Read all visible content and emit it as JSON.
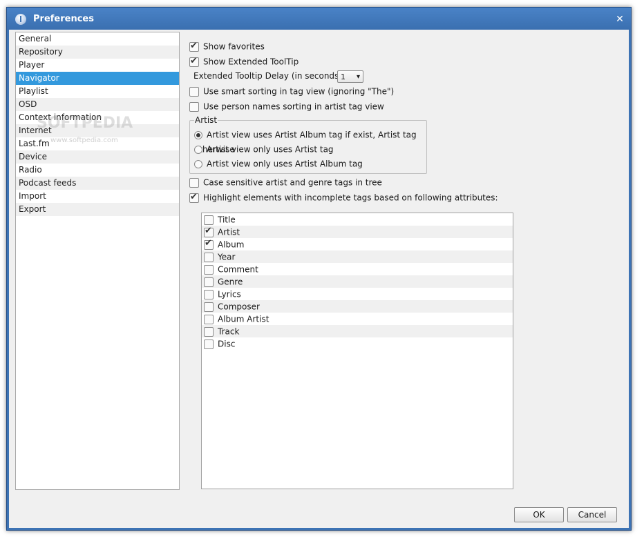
{
  "window": {
    "title": "Preferences",
    "icon": "app-icon",
    "close_glyph": "✕",
    "accent": "#3d73b4",
    "selection_color": "#3399dd"
  },
  "sidebar": {
    "items": [
      {
        "label": "General"
      },
      {
        "label": "Repository"
      },
      {
        "label": "Player"
      },
      {
        "label": "Navigator",
        "selected": true
      },
      {
        "label": "Playlist"
      },
      {
        "label": "OSD"
      },
      {
        "label": "Context information"
      },
      {
        "label": "Internet"
      },
      {
        "label": "Last.fm"
      },
      {
        "label": "Device"
      },
      {
        "label": "Radio"
      },
      {
        "label": "Podcast feeds"
      },
      {
        "label": "Import"
      },
      {
        "label": "Export"
      }
    ]
  },
  "watermark": {
    "text": "SOFTPEDIA",
    "url": "www.softpedia.com"
  },
  "options": {
    "show_favorites": {
      "label": "Show favorites",
      "checked": true
    },
    "show_extended_tooltip": {
      "label": "Show Extended ToolTip",
      "checked": true
    },
    "tooltip_delay": {
      "label": "Extended Tooltip Delay (in seconds)",
      "value": "1"
    },
    "smart_sorting": {
      "label": "Use smart sorting in tag view (ignoring \"The\")",
      "checked": false
    },
    "person_names_sorting": {
      "label": "Use person names sorting in artist tag view",
      "checked": false
    },
    "case_sensitive": {
      "label": "Case sensitive artist and genre tags in tree",
      "checked": false
    },
    "highlight_incomplete": {
      "label": "Highlight elements with incomplete tags based on following attributes:",
      "checked": true
    }
  },
  "artist_group": {
    "title": "Artist",
    "options": [
      {
        "label": "Artist view uses Artist Album tag if exist, Artist tag otherwise",
        "selected": true
      },
      {
        "label": "Artist view only uses Artist tag",
        "selected": false
      },
      {
        "label": "Artist view only uses Artist Album tag",
        "selected": false
      }
    ]
  },
  "attributes": [
    {
      "label": "Title",
      "checked": false
    },
    {
      "label": "Artist",
      "checked": true
    },
    {
      "label": "Album",
      "checked": true
    },
    {
      "label": "Year",
      "checked": false
    },
    {
      "label": "Comment",
      "checked": false
    },
    {
      "label": "Genre",
      "checked": false
    },
    {
      "label": "Lyrics",
      "checked": false
    },
    {
      "label": "Composer",
      "checked": false
    },
    {
      "label": "Album Artist",
      "checked": false
    },
    {
      "label": "Track",
      "checked": false
    },
    {
      "label": "Disc",
      "checked": false
    }
  ],
  "buttons": {
    "ok": "OK",
    "cancel": "Cancel"
  }
}
